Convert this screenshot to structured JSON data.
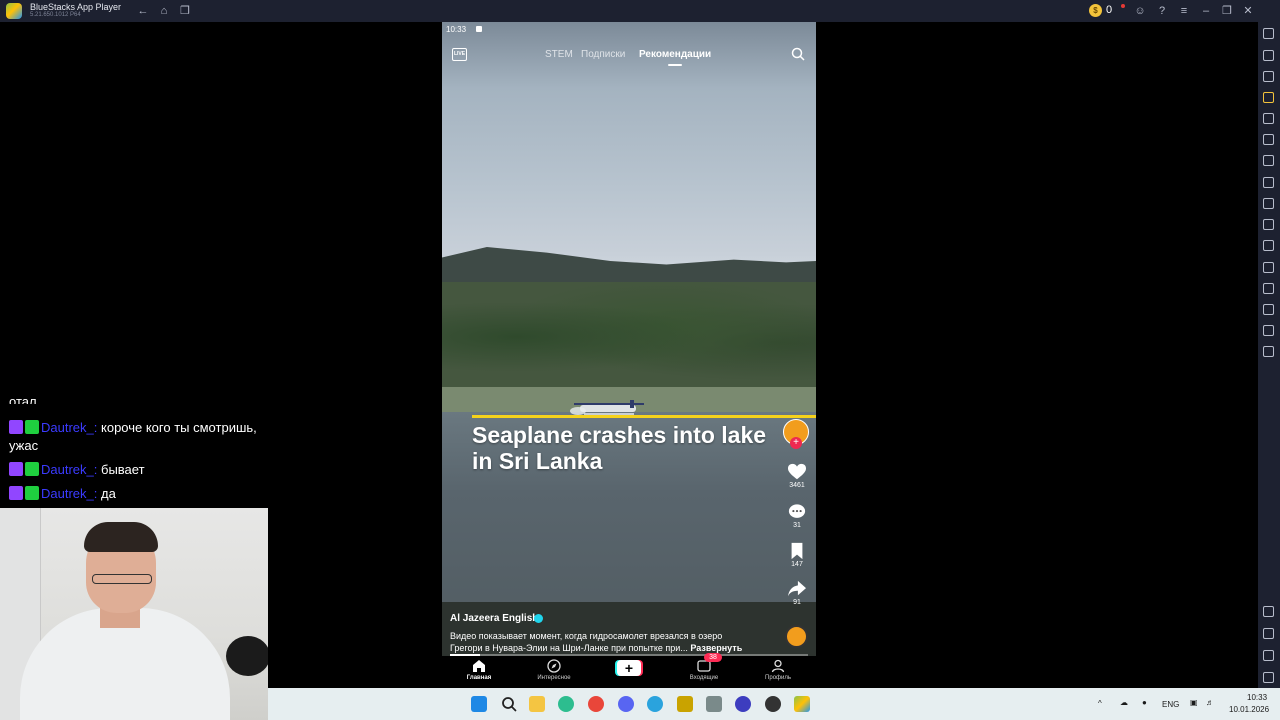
{
  "window": {
    "title": "BlueStacks App Player",
    "version": "5.21.650.1012 P64",
    "coins": "0"
  },
  "phone": {
    "status_time": "10:33",
    "tabs": [
      "STEM",
      "Подписки",
      "Рекомендации"
    ],
    "active_tab": "Рекомендации",
    "headline": "Seaplane crashes into lake in Sri Lanka",
    "likes": "3461",
    "comments": "31",
    "saves": "147",
    "shares": "91",
    "author": "Al Jazeera English",
    "description": "Видео показывает момент, когда гидросамолет врезался в озеро Грегори в Нувара-Элии на Шри-Ланке при попытке при...",
    "expand_label": "Развернуть",
    "nav": {
      "home": "Главная",
      "explore": "Интересное",
      "create": "+",
      "inbox": "Входящие",
      "inbox_badge": "38",
      "profile": "Профиль"
    }
  },
  "chat": {
    "cut_line": "отал",
    "messages": [
      {
        "user": "Dautrek_:",
        "text": "короче кого ты смотришь, ужас"
      },
      {
        "user": "Dautrek_:",
        "text": "бывает"
      },
      {
        "user": "Dautrek_:",
        "text": "да"
      }
    ]
  },
  "taskbar": {
    "language": "ENG",
    "time": "10:33",
    "date": "10.01.2026"
  },
  "colors": {
    "accent_pink": "#fe2c55",
    "accent_cyan": "#25f4ee",
    "headline_bar": "#f5d21b",
    "twitch_purple": "#9146ff"
  }
}
